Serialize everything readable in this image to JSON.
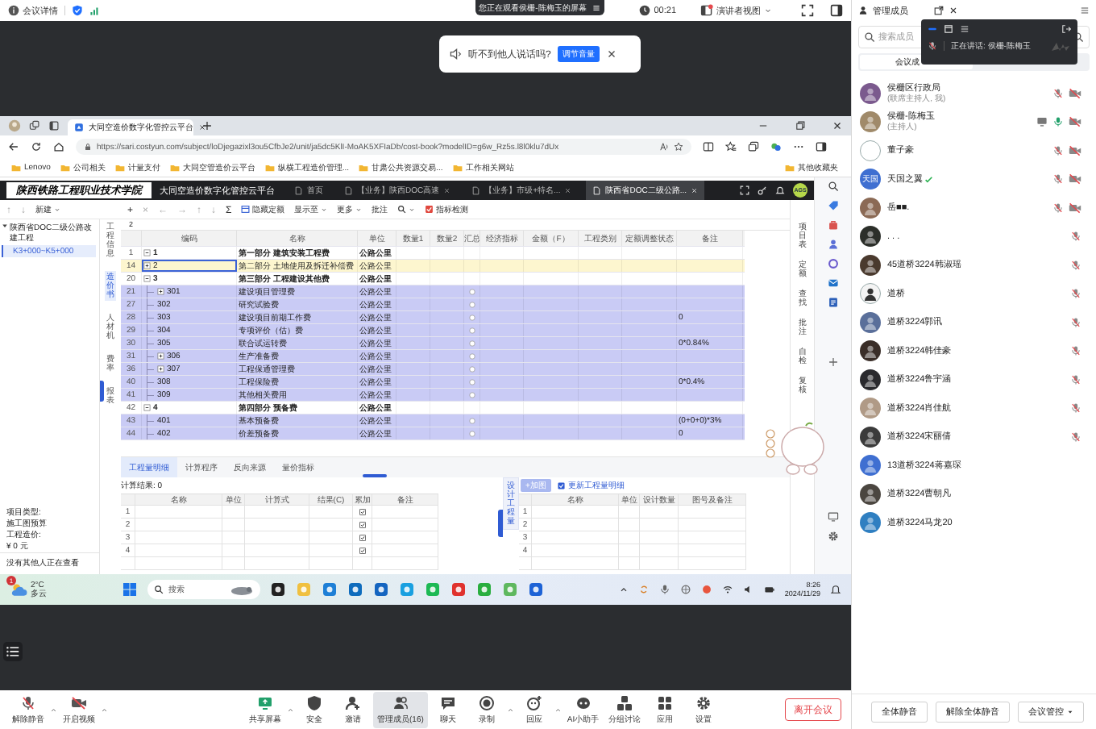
{
  "top_bar": {
    "meeting_info": "会议详情",
    "timer": "00:21",
    "view_menu": "演讲者视图"
  },
  "viewing_banner": "您正在观看侯栅-陈梅玉的屏幕",
  "audio_tip": {
    "text": "听不到他人说话吗?",
    "button": "调节音量"
  },
  "shared_screen": {
    "browser": {
      "tab_title": "大同空造价数字化管控云平台",
      "url": "https://sari.costyun.com/subject/loDjegazixl3ou5CfbJe2/unit/ja5dc5KlI-MoAK5XFIaDb/cost-book?modelID=g6w_Rz5s.l8l0klu7dUx",
      "bookmarks": [
        "Lenovo",
        "公司相关",
        "计量支付",
        "大同空管造价云平台",
        "纵横工程造价管理...",
        "甘肃公共资源交易...",
        "工作相关网站"
      ],
      "other_bookmarks": "其他收藏夹"
    },
    "app": {
      "logo": "陕西铁路工程职业技术学院",
      "title": "大同空造价数字化管控云平台",
      "tabs": [
        {
          "label": "首页",
          "selected": false,
          "closable": false
        },
        {
          "label": "【业务】陕西DOC高速",
          "selected": false,
          "closable": true
        },
        {
          "label": "【业务】市级+特名...",
          "selected": false,
          "closable": true
        },
        {
          "label": "陕西省DOC二级公路...",
          "selected": true,
          "closable": true
        }
      ],
      "user_avatar": "AGS",
      "side_tools": [
        {
          "kind": "glyph",
          "label": "↑",
          "disabled": true
        },
        {
          "kind": "glyph",
          "label": "↓",
          "disabled": true
        },
        {
          "kind": "menu",
          "label": "新建",
          "disabled": false
        }
      ],
      "tools": [
        {
          "kind": "glyph",
          "label": "+",
          "disabled": false
        },
        {
          "kind": "glyph",
          "label": "×",
          "disabled": true
        },
        {
          "kind": "glyph",
          "label": "←",
          "disabled": true
        },
        {
          "kind": "glyph",
          "label": "→",
          "disabled": true
        },
        {
          "kind": "glyph",
          "label": "↑",
          "disabled": true
        },
        {
          "kind": "glyph",
          "label": "↓",
          "disabled": true
        },
        {
          "kind": "glyph",
          "label": "Σ",
          "disabled": false
        },
        {
          "kind": "hide",
          "label": "隐藏定额",
          "disabled": false
        },
        {
          "kind": "menu",
          "label": "显示至",
          "disabled": false
        },
        {
          "kind": "menu",
          "label": "更多",
          "disabled": false
        },
        {
          "kind": "text",
          "label": "批注",
          "disabled": false
        },
        {
          "kind": "search",
          "disabled": false
        },
        {
          "kind": "check",
          "label": "指标检测",
          "disabled": false
        }
      ],
      "formula": "2",
      "project_tree": [
        {
          "label": "陕西省DOC二级公路改建工程",
          "expanded": true,
          "selected": false,
          "children": [
            {
              "label": "K3+000~K5+000",
              "selected": true
            }
          ]
        }
      ],
      "project_type_label": "项目类型:",
      "project_type": "施工图预算",
      "cost_label": "工程造价:",
      "cost": "¥ 0 元",
      "viewers": "没有其他人正在查看",
      "side_tabs": [
        {
          "label": "工程信息",
          "selected": false
        },
        {
          "label": "造价书",
          "selected": true
        },
        {
          "label": "人材机",
          "selected": false
        },
        {
          "label": "费率",
          "selected": false
        },
        {
          "label": "报表",
          "selected": false
        }
      ],
      "right_tools": [
        "项目表",
        "定额",
        "查找",
        "批注",
        "自检",
        "复核"
      ],
      "table": {
        "columns": [
          "编码",
          "名称",
          "单位",
          "数量1",
          "数量2",
          "汇总",
          "经济指标",
          "金额（F）",
          "工程类别",
          "定额调整状态",
          "备注"
        ],
        "rows": [
          {
            "row": "1",
            "code": "1",
            "name": "第一部分 建筑安装工程费",
            "unit": "公路公里",
            "expanded": true,
            "selected": false
          },
          {
            "row": "14",
            "code": "2",
            "name": "第二部分 土地使用及拆迁补偿费",
            "unit": "公路公里",
            "expanded": false,
            "selected": true
          },
          {
            "row": "20",
            "code": "3",
            "name": "第三部分 工程建设其他费",
            "unit": "公路公里",
            "expanded": true,
            "selected": false,
            "children": [
              {
                "row": "21",
                "code": "301",
                "name": "建设项目管理费",
                "unit": "公路公里",
                "expanded": false,
                "summary": false,
                "selected": false
              },
              {
                "row": "27",
                "code": "302",
                "name": "研究试验费",
                "unit": "公路公里",
                "summary": false,
                "selected": false
              },
              {
                "row": "28",
                "code": "303",
                "name": "建设项目前期工作费",
                "unit": "公路公里",
                "summary": false,
                "note": "0",
                "selected": false
              },
              {
                "row": "29",
                "code": "304",
                "name": "专项评价（估）费",
                "unit": "公路公里",
                "summary": false,
                "selected": false
              },
              {
                "row": "30",
                "code": "305",
                "name": "联合试运转费",
                "unit": "公路公里",
                "summary": false,
                "note": "0*0.84%",
                "selected": false
              },
              {
                "row": "31",
                "code": "306",
                "name": "生产准备费",
                "unit": "公路公里",
                "expanded": false,
                "summary": false,
                "selected": false
              },
              {
                "row": "36",
                "code": "307",
                "name": "工程保通管理费",
                "unit": "公路公里",
                "expanded": false,
                "summary": false,
                "selected": false
              },
              {
                "row": "40",
                "code": "308",
                "name": "工程保险费",
                "unit": "公路公里",
                "summary": false,
                "note": "0*0.4%",
                "selected": false
              },
              {
                "row": "41",
                "code": "309",
                "name": "其他相关费用",
                "unit": "公路公里",
                "summary": false,
                "selected": false
              }
            ]
          },
          {
            "row": "42",
            "code": "4",
            "name": "第四部分 预备费",
            "unit": "公路公里",
            "expanded": true,
            "selected": false,
            "children": [
              {
                "row": "43",
                "code": "401",
                "name": "基本预备费",
                "unit": "公路公里",
                "summary": false,
                "note": "(0+0+0)*3%",
                "selected": false
              },
              {
                "row": "44",
                "code": "402",
                "name": "价差预备费",
                "unit": "公路公里",
                "summary": false,
                "note": "0",
                "selected": false
              }
            ]
          }
        ]
      },
      "detail_tabs": [
        {
          "label": "工程量明细",
          "selected": true
        },
        {
          "label": "计算程序",
          "selected": false
        },
        {
          "label": "反向来源",
          "selected": false
        },
        {
          "label": "量价指标",
          "selected": false
        }
      ],
      "calc_result": "计算结果: 0",
      "quantity_table": {
        "columns": [
          "名称",
          "单位",
          "计算式",
          "结果(C)",
          "累加",
          "备注"
        ],
        "rows": [
          {
            "row": "1",
            "accumulate": true
          },
          {
            "row": "2",
            "accumulate": true
          },
          {
            "row": "3",
            "accumulate": true
          },
          {
            "row": "4",
            "accumulate": true
          }
        ]
      },
      "design_tab": "设计工程量",
      "add_button": "+加图",
      "update_option": {
        "label": "更新工程量明细",
        "checked": true
      },
      "design_table": {
        "columns": [
          "名称",
          "单位",
          "设计数量",
          "图号及备注"
        ],
        "rows": [
          "1",
          "2",
          "3",
          "4"
        ]
      }
    },
    "taskbar": {
      "temperature": "2°C",
      "weather": "多云",
      "weather_badge": "1",
      "search": "搜索",
      "time": "8:26",
      "date": "2024/11/29"
    }
  },
  "toolbar": {
    "left": [
      {
        "kind": "mic",
        "label": "解除静音",
        "menu": true,
        "selected": false
      },
      {
        "kind": "camera",
        "label": "开启视频",
        "menu": true,
        "selected": false
      }
    ],
    "center": [
      {
        "kind": "share",
        "label": "共享屏幕",
        "menu": true,
        "selected": false
      },
      {
        "kind": "security",
        "label": "安全",
        "menu": false,
        "selected": false
      },
      {
        "kind": "invite",
        "label": "邀请",
        "menu": false,
        "selected": false
      },
      {
        "kind": "members",
        "label": "管理成员(16)",
        "menu": false,
        "selected": true
      },
      {
        "kind": "chat",
        "label": "聊天",
        "menu": false,
        "selected": false
      },
      {
        "kind": "record",
        "label": "录制",
        "menu": true,
        "selected": false
      },
      {
        "kind": "reaction",
        "label": "回应",
        "menu": true,
        "selected": false
      },
      {
        "kind": "assistant",
        "label": "AI小助手",
        "menu": false,
        "selected": false
      },
      {
        "kind": "breakout",
        "label": "分组讨论",
        "menu": false,
        "selected": false
      },
      {
        "kind": "apps",
        "label": "应用",
        "menu": false,
        "selected": false
      },
      {
        "kind": "settings",
        "label": "设置",
        "menu": false,
        "selected": false
      }
    ]
  },
  "leave_button": "离开会议",
  "members_panel": {
    "title": "管理成员",
    "search_placeholder": "搜索成员",
    "tab": "会议成",
    "speaking": "正在讲话: 侯栅-陈梅玉",
    "members": [
      {
        "name": "侯栅区行政局",
        "role": "(联席主持人, 我)",
        "avatar": {
          "kind": "photo",
          "color": "#7b5a8e"
        },
        "muted": true,
        "video_off": true,
        "sharing": false
      },
      {
        "name": "侯栅-陈梅玉",
        "role": "(主持人)",
        "avatar": {
          "kind": "photo",
          "color": "#a08a6a"
        },
        "muted": false,
        "video_off": true,
        "sharing": true
      },
      {
        "name": "董子豪",
        "avatar": {
          "kind": "default",
          "color": "#ffffff"
        },
        "muted": true,
        "video_off": true,
        "sharing": false
      },
      {
        "name": "天国之翼",
        "verified": true,
        "avatar": {
          "kind": "text",
          "color": "#3f6fd1",
          "text": "天国"
        },
        "muted": true,
        "video_off": true,
        "sharing": false
      },
      {
        "name": "岳■■.",
        "avatar": {
          "kind": "photo",
          "color": "#8b6a55"
        },
        "muted": true,
        "video_off": true,
        "sharing": false
      },
      {
        "name": ". . .",
        "avatar": {
          "kind": "photo",
          "color": "#2c2f2a"
        },
        "muted": true,
        "sharing": false
      },
      {
        "name": "45道桥3224韩淑瑶",
        "avatar": {
          "kind": "photo",
          "color": "#4a3a2e"
        },
        "muted": true,
        "sharing": false
      },
      {
        "name": "道桥",
        "avatar": {
          "kind": "photo",
          "color": "#f4f4f4"
        },
        "muted": true,
        "sharing": false
      },
      {
        "name": "道桥3224郭讯",
        "avatar": {
          "kind": "photo",
          "color": "#5a6f9a"
        },
        "muted": true,
        "sharing": false
      },
      {
        "name": "道桥3224韩佳豪",
        "avatar": {
          "kind": "photo",
          "color": "#3a2e28"
        },
        "muted": true,
        "sharing": false
      },
      {
        "name": "道桥3224鲁宇涵",
        "avatar": {
          "kind": "photo",
          "color": "#2a2a2e"
        },
        "muted": true,
        "sharing": false
      },
      {
        "name": "道桥3224肖佳航",
        "avatar": {
          "kind": "photo",
          "color": "#b09a86"
        },
        "muted": true,
        "sharing": false
      },
      {
        "name": "道桥3224宋丽倩",
        "avatar": {
          "kind": "photo",
          "color": "#3b3b3b"
        },
        "muted": true,
        "sharing": false
      },
      {
        "name": "13道桥3224蒋嘉琛",
        "avatar": {
          "kind": "photo",
          "color": "#3f6fd1"
        },
        "sharing": false
      },
      {
        "name": "道桥3224曹朝凡",
        "avatar": {
          "kind": "photo",
          "color": "#4b4640"
        },
        "sharing": false
      },
      {
        "name": "道桥3224马龙20",
        "avatar": {
          "kind": "photo",
          "color": "#2f7fc1"
        },
        "sharing": false
      }
    ],
    "buttons": [
      "全体静音",
      "解除全体静音",
      "会议管控"
    ]
  }
}
